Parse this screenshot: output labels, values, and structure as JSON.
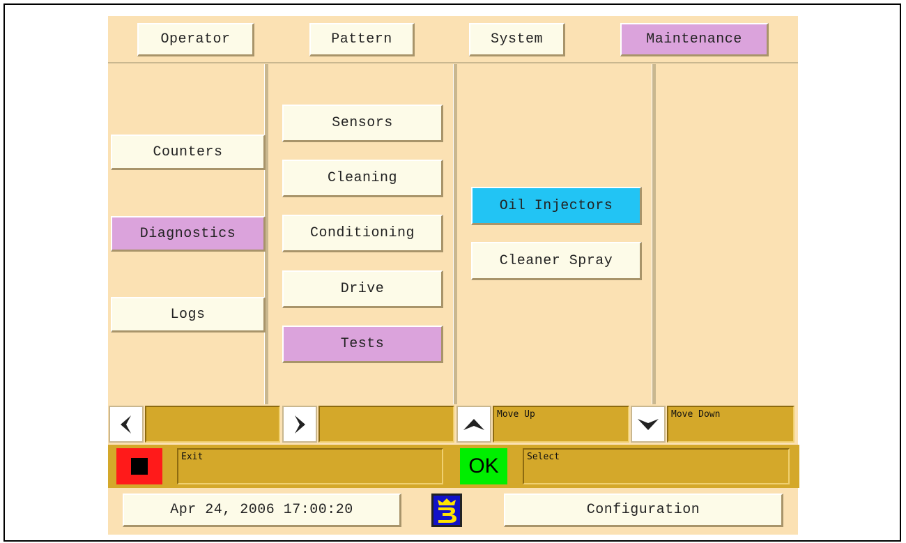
{
  "top_tabs": [
    {
      "label": "Operator",
      "active": false
    },
    {
      "label": "Pattern",
      "active": false
    },
    {
      "label": "System",
      "active": false
    },
    {
      "label": "Maintenance",
      "active": true
    }
  ],
  "column1": [
    {
      "label": "Counters",
      "active": false
    },
    {
      "label": "Diagnostics",
      "active": true
    },
    {
      "label": "Logs",
      "active": false
    }
  ],
  "column2": [
    {
      "label": "Sensors",
      "active": false
    },
    {
      "label": "Cleaning",
      "active": false
    },
    {
      "label": "Conditioning",
      "active": false
    },
    {
      "label": "Drive",
      "active": false
    },
    {
      "label": "Tests",
      "active": true
    }
  ],
  "column3": [
    {
      "label": "Oil Injectors",
      "selected": true
    },
    {
      "label": "Cleaner Spray",
      "selected": false
    }
  ],
  "nav_bar": {
    "left_icon": "chevron-left-icon",
    "right_icon": "chevron-right-icon",
    "up_icon": "arrow-up-icon",
    "up_label": "Move Up",
    "down_icon": "arrow-down-icon",
    "down_label": "Move Down"
  },
  "action_bar": {
    "stop_icon": "stop-icon",
    "exit_label": "Exit",
    "ok_label": "OK",
    "select_label": "Select"
  },
  "footer": {
    "datetime": "Apr 24, 2006 17:00:20",
    "logo_icon": "brand-logo-icon",
    "config_label": "Configuration"
  },
  "colors": {
    "panel_bg": "#fbe1b3",
    "button_bg": "#fdfbe8",
    "active_pink": "#dba3dc",
    "selected_cyan": "#22c4f4",
    "bar_gold": "#d4a82a",
    "stop_red": "#ff1a1a",
    "ok_green": "#00ee00"
  }
}
